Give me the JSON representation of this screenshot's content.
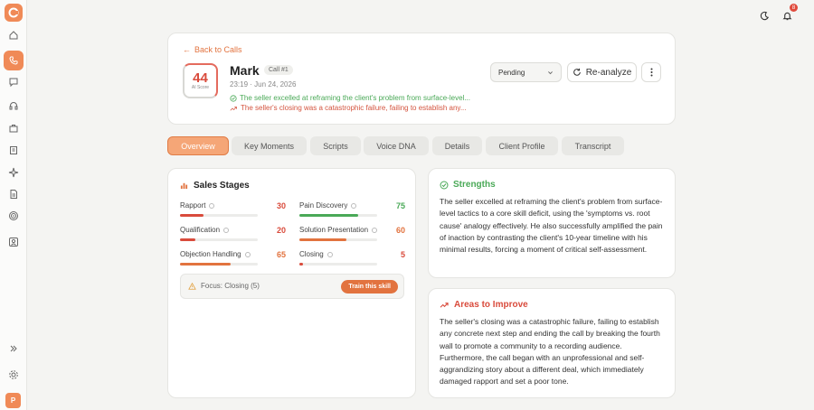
{
  "header": {
    "back_label": "Back to Calls",
    "score": "44",
    "score_label": "AI Score",
    "name": "Mark",
    "call_badge": "Call #1",
    "date": "23:19 · Jun 24, 2026",
    "summary_good": "The seller excelled at reframing the client's problem from surface-level...",
    "summary_bad": "The seller's closing was a catastrophic failure, failing to establish any...",
    "status_value": "Pending",
    "reanalyze_label": "Re-analyze"
  },
  "notifications": {
    "count": "8"
  },
  "sidebar": {
    "avatar_initial": "P"
  },
  "tabs": [
    "Overview",
    "Key Moments",
    "Scripts",
    "Voice DNA",
    "Details",
    "Client Profile",
    "Transcript"
  ],
  "sales_stages": {
    "title": "Sales Stages",
    "metrics": [
      {
        "label": "Rapport",
        "value": "30",
        "pct": 30,
        "color": "#d94b3c"
      },
      {
        "label": "Pain Discovery",
        "value": "75",
        "pct": 75,
        "color": "#4aa957"
      },
      {
        "label": "Qualification",
        "value": "20",
        "pct": 20,
        "color": "#d94b3c"
      },
      {
        "label": "Solution Presentation",
        "value": "60",
        "pct": 60,
        "color": "#e2733f"
      },
      {
        "label": "Objection Handling",
        "value": "65",
        "pct": 65,
        "color": "#e2733f"
      },
      {
        "label": "Closing",
        "value": "5",
        "pct": 5,
        "color": "#d94b3c"
      }
    ],
    "focus_text": "Focus: Closing (5)",
    "train_label": "Train this skill"
  },
  "strengths": {
    "title": "Strengths",
    "text": "The seller excelled at reframing the client's problem from surface-level tactics to a core skill deficit, using the 'symptoms vs. root cause' analogy effectively. He also successfully amplified the pain of inaction by contrasting the client's 10-year timeline with his minimal results, forcing a moment of critical self-assessment."
  },
  "improve": {
    "title": "Areas to Improve",
    "text": "The seller's closing was a catastrophic failure, failing to establish any concrete next step and ending the call by breaking the fourth wall to promote a community to a recording audience. Furthermore, the call began with an unprofessional and self-aggrandizing story about a different deal, which immediately damaged rapport and set a poor tone."
  },
  "colors": {
    "accent": "#e2733f",
    "good": "#4aa957",
    "bad": "#d94b3c"
  }
}
